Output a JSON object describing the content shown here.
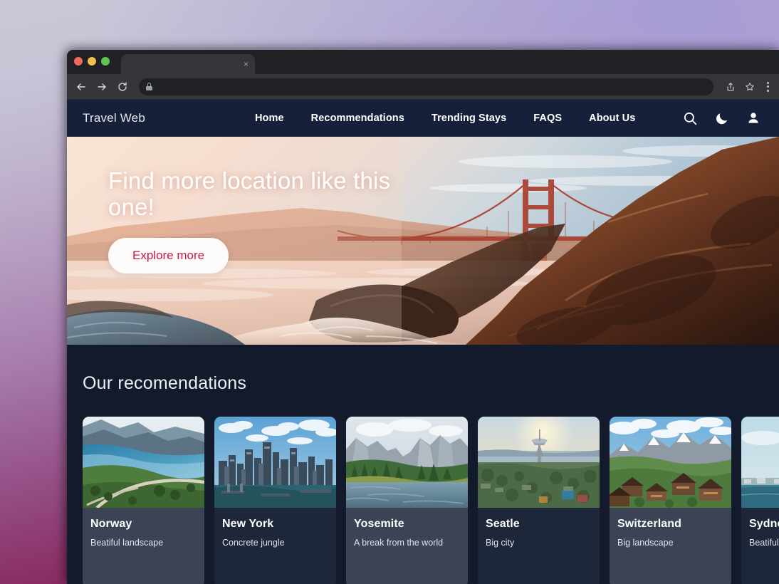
{
  "browser": {
    "tab": {
      "title": "",
      "close_label": "×"
    },
    "toolbar": {
      "back_icon": "arrow-left-icon",
      "forward_icon": "arrow-right-icon",
      "reload_icon": "reload-icon",
      "lock_icon": "lock-icon",
      "url": "",
      "share_icon": "share-icon",
      "bookmark_icon": "star-icon",
      "menu_icon": "kebab-menu-icon"
    },
    "window_controls": [
      "close",
      "minimize",
      "maximize"
    ]
  },
  "site": {
    "brand": "Travel Web",
    "nav": [
      {
        "label": "Home"
      },
      {
        "label": "Recommendations"
      },
      {
        "label": "Trending Stays"
      },
      {
        "label": "FAQS"
      },
      {
        "label": "About Us"
      }
    ],
    "nav_icons": [
      {
        "name": "search-icon"
      },
      {
        "name": "moon-icon"
      },
      {
        "name": "account-icon"
      }
    ]
  },
  "hero": {
    "title": "Find more location like this one!",
    "cta": "Explore more",
    "cta_color": "#c9184a",
    "image_alt": "golden-gate-bridge-coast"
  },
  "recommendations": {
    "heading": "Our recomendations",
    "cards": [
      {
        "name": "Norway",
        "desc": "Beatiful landscape",
        "tone": "lite"
      },
      {
        "name": "New York",
        "desc": "Concrete jungle",
        "tone": "dark"
      },
      {
        "name": "Yosemite",
        "desc": "A break from the world",
        "tone": "lite"
      },
      {
        "name": "Seatle",
        "desc": "Big city",
        "tone": "dark"
      },
      {
        "name": "Switzerland",
        "desc": "Big landscape",
        "tone": "lite"
      },
      {
        "name": "Sydney",
        "desc": "Beatiful landscape",
        "tone": "dark"
      }
    ]
  },
  "theme": {
    "page_bg": "#121a2b",
    "nav_bg": "#16203a",
    "card_lite": "#3c4354",
    "card_dark": "#1d2739",
    "accent": "#c9184a"
  }
}
